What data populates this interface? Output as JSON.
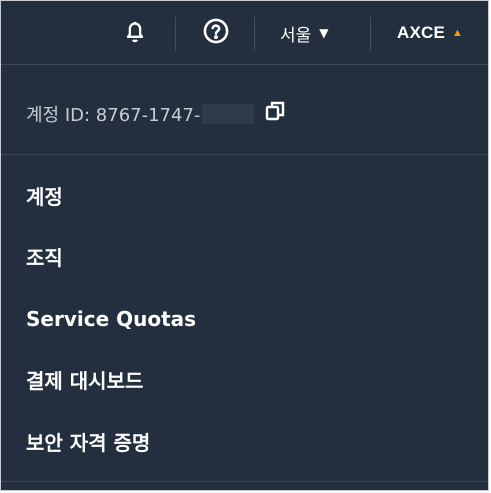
{
  "header": {
    "region_label": "서울",
    "region_caret": "▼",
    "user_label": "AXCE",
    "user_caret": "▲"
  },
  "account": {
    "id_text": "계정 ID: 8767-1747-"
  },
  "menu": {
    "items": [
      {
        "label": "계정"
      },
      {
        "label": "조직"
      },
      {
        "label": "Service Quotas"
      },
      {
        "label": "결제 대시보드"
      },
      {
        "label": "보안 자격 증명"
      }
    ]
  },
  "colors": {
    "background": "#232f3e",
    "accent": "#ff9900",
    "divider": "#3b4756"
  }
}
